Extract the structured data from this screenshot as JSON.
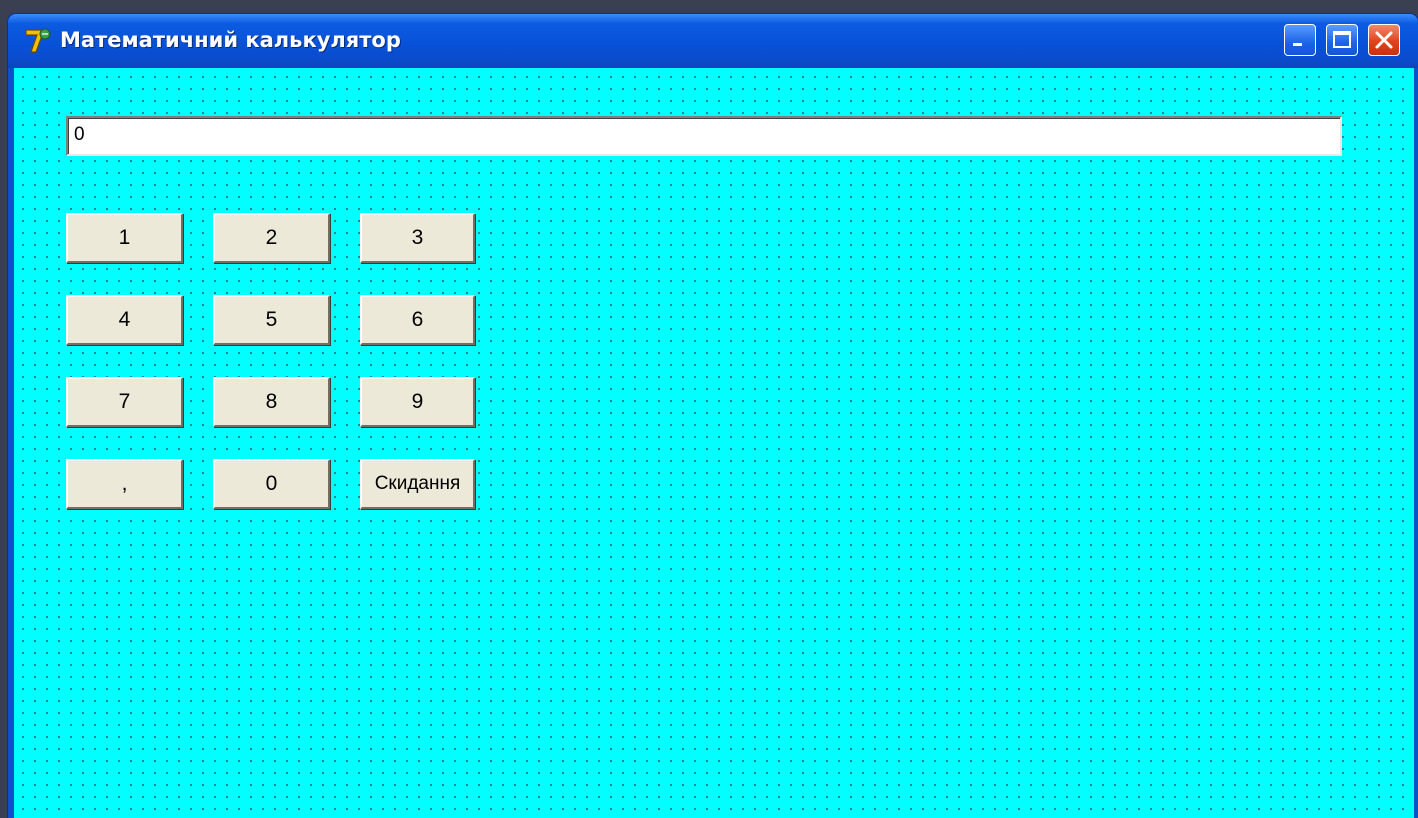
{
  "window": {
    "title": "Математичний калькулятор",
    "icon": "delphi-app-icon",
    "controls": {
      "minimize_icon": "minimize-icon",
      "maximize_icon": "maximize-icon",
      "close_icon": "close-icon"
    }
  },
  "display": {
    "value": "0"
  },
  "keypad": {
    "rows": [
      [
        "1",
        "2",
        "3"
      ],
      [
        "4",
        "5",
        "6"
      ],
      [
        "7",
        "8",
        "9"
      ],
      [
        ",",
        "0",
        "Скидання"
      ]
    ]
  },
  "colors": {
    "form_background": "#00ffff",
    "titlebar": "#0852d9",
    "button_face": "#ece9d8"
  }
}
